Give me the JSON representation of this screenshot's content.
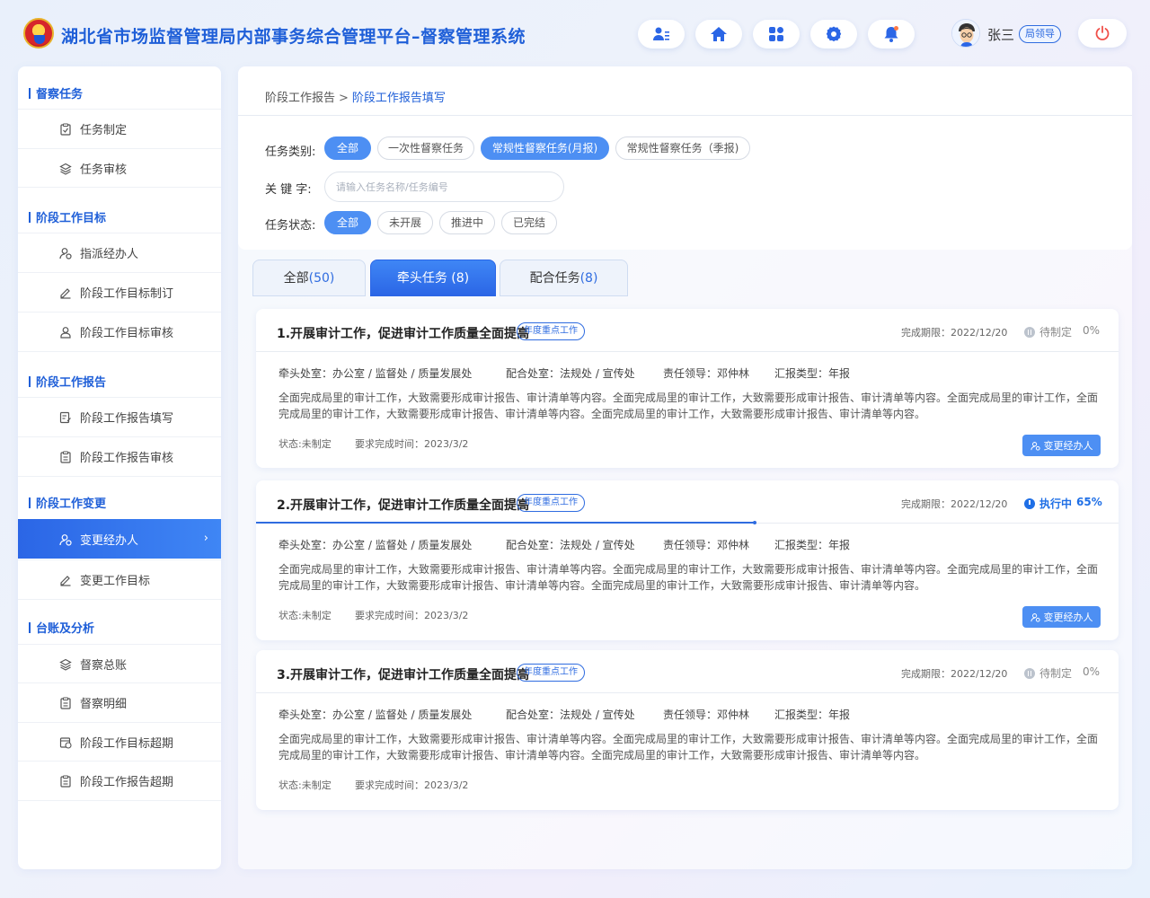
{
  "header": {
    "title": "湖北省市场监督管理局内部事务综合管理平台–督察管理系统",
    "user_name": "张三",
    "user_role": "局领导"
  },
  "sidebar": {
    "sections": [
      {
        "title": "督察任务",
        "items": [
          "任务制定",
          "任务审核"
        ]
      },
      {
        "title": "阶段工作目标",
        "items": [
          "指派经办人",
          "阶段工作目标制订",
          "阶段工作目标审核"
        ]
      },
      {
        "title": "阶段工作报告",
        "items": [
          "阶段工作报告填写",
          "阶段工作报告审核"
        ]
      },
      {
        "title": "阶段工作变更",
        "items": [
          "变更经办人",
          "变更工作目标"
        ]
      },
      {
        "title": "台账及分析",
        "items": [
          "督察总账",
          "督察明细",
          "阶段工作目标超期",
          "阶段工作报告超期"
        ]
      }
    ],
    "active_item": "变更经办人"
  },
  "breadcrumb": {
    "parent": "阶段工作报告",
    "separator": ">",
    "current": "阶段工作报告填写"
  },
  "filters": {
    "category_label": "任务类别:",
    "category_options": [
      "全部",
      "一次性督察任务",
      "常规性督察任务(月报)",
      "常规性督察任务（季报)"
    ],
    "keyword_label": "关 键 字:",
    "keyword_placeholder": "请输入任务名称/任务编号",
    "status_label": "任务状态:",
    "status_options": [
      "全部",
      "未开展",
      "推进中",
      "已完结"
    ]
  },
  "tabs": [
    {
      "label": "全部",
      "count": "(50)"
    },
    {
      "label": "牵头任务",
      "count": "(8)"
    },
    {
      "label": "配合任务",
      "count": "(8)"
    }
  ],
  "cards": [
    {
      "title": "1.开展审计工作，促进审计工作质量全面提高",
      "tag": "年度重点工作",
      "deadline": "完成期限：2022/12/20",
      "status": "待制定",
      "percent": "0%",
      "progress": 0,
      "lead_dept": "牵头处室：办公室 / 监督处 / 质量发展处",
      "coop_dept": "配合处室：法规处 / 宣传处",
      "leader": "责任领导：邓仲林",
      "report_type": "汇报类型：年报",
      "desc": "全面完成局里的审计工作，大致需要形成审计报告、审计清单等内容。全面完成局里的审计工作，大致需要形成审计报告、审计清单等内容。全面完成局里的审计工作，全面完成局里的审计工作，大致需要形成审计报告、审计清单等内容。全面完成局里的审计工作，大致需要形成审计报告、审计清单等内容。",
      "state": "状态:未制定",
      "due": "要求完成时间：2023/3/2",
      "button": "变更经办人"
    },
    {
      "title": "2.开展审计工作，促进审计工作质量全面提高",
      "tag": "年度重点工作",
      "deadline": "完成期限：2022/12/20",
      "status": "执行中",
      "percent": "65%",
      "progress": 0.578,
      "lead_dept": "牵头处室：办公室 / 监督处 / 质量发展处",
      "coop_dept": "配合处室：法规处 / 宣传处",
      "leader": "责任领导：邓仲林",
      "report_type": "汇报类型：年报",
      "desc": "全面完成局里的审计工作，大致需要形成审计报告、审计清单等内容。全面完成局里的审计工作，大致需要形成审计报告、审计清单等内容。全面完成局里的审计工作，全面完成局里的审计工作，大致需要形成审计报告、审计清单等内容。全面完成局里的审计工作，大致需要形成审计报告、审计清单等内容。",
      "state": "状态:未制定",
      "due": "要求完成时间：2023/3/2",
      "button": "变更经办人"
    },
    {
      "title": "3.开展审计工作，促进审计工作质量全面提高",
      "tag": "年度重点工作",
      "deadline": "完成期限：2022/12/20",
      "status": "待制定",
      "percent": "0%",
      "progress": 0,
      "lead_dept": "牵头处室：办公室 / 监督处 / 质量发展处",
      "coop_dept": "配合处室：法规处 / 宣传处",
      "leader": "责任领导：邓仲林",
      "report_type": "汇报类型：年报",
      "desc": "全面完成局里的审计工作，大致需要形成审计报告、审计清单等内容。全面完成局里的审计工作，大致需要形成审计报告、审计清单等内容。全面完成局里的审计工作，全面完成局里的审计工作，大致需要形成审计报告、审计清单等内容。全面完成局里的审计工作，大致需要形成审计报告、审计清单等内容。",
      "state": "状态:未制定",
      "due": "要求完成时间：2023/3/2"
    }
  ],
  "colors": {
    "accent": "#2f6ce0",
    "active_menu": "#2b66e6",
    "chip_on": "#4d8ff3",
    "running": "#1f6fe6"
  }
}
